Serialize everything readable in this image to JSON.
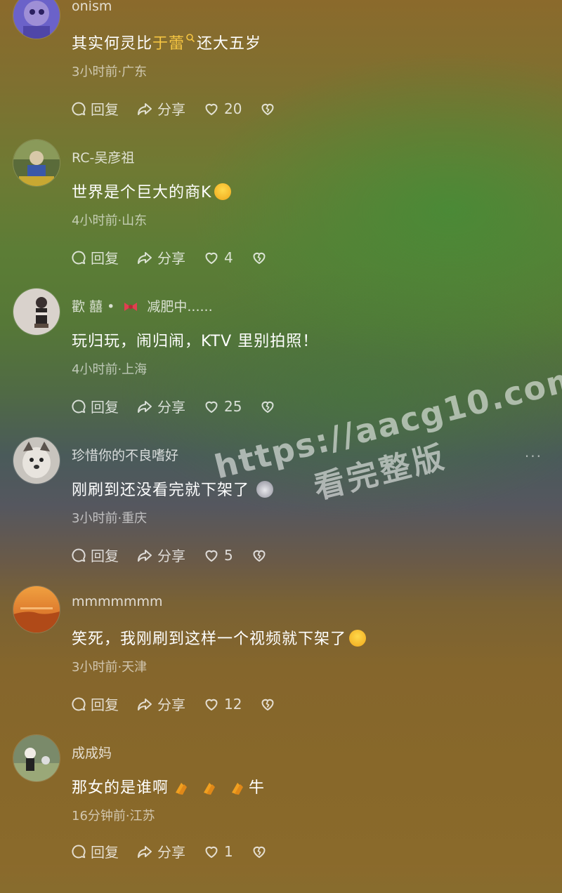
{
  "comments": [
    {
      "username": "onism",
      "text_before": "其实何灵比",
      "text_highlight": "于蕾",
      "text_after": "还大五岁",
      "time_location": "3小时前·广东",
      "reply_label": "回复",
      "share_label": "分享",
      "likes": "20"
    },
    {
      "username": "RC-吴彦祖",
      "text": "世界是个巨大的商K",
      "time_location": "4小时前·山东",
      "reply_label": "回复",
      "share_label": "分享",
      "likes": "4"
    },
    {
      "username_a": "歡 囍 •",
      "username_b": "减肥中......",
      "text": "玩归玩，闹归闹，KTV 里别拍照！",
      "time_location": "4小时前·上海",
      "reply_label": "回复",
      "share_label": "分享",
      "likes": "25"
    },
    {
      "username": "珍惜你的不良嗜好",
      "text": "刚刷到还没看完就下架了",
      "time_location": "3小时前·重庆",
      "reply_label": "回复",
      "share_label": "分享",
      "likes": "5",
      "more": "···"
    },
    {
      "username": "mmmmmmm",
      "text": "笑死，我刚刷到这样一个视频就下架了",
      "time_location": "3小时前·天津",
      "reply_label": "回复",
      "share_label": "分享",
      "likes": "12"
    },
    {
      "username": "成成妈",
      "text_before": "那女的是谁啊",
      "text_after": "牛",
      "time_location": "16分钟前·江苏",
      "reply_label": "回复",
      "share_label": "分享",
      "likes": "1"
    }
  ],
  "watermark": {
    "line1": "https://aacg10.com",
    "line2": "看完整版"
  },
  "icons": {
    "reply": "speech-bubble-icon",
    "share": "share-arrow-icon",
    "like": "heart-icon",
    "dislike": "broken-heart-icon",
    "search": "search-icon"
  },
  "colors": {
    "highlight": "#f5c542"
  }
}
